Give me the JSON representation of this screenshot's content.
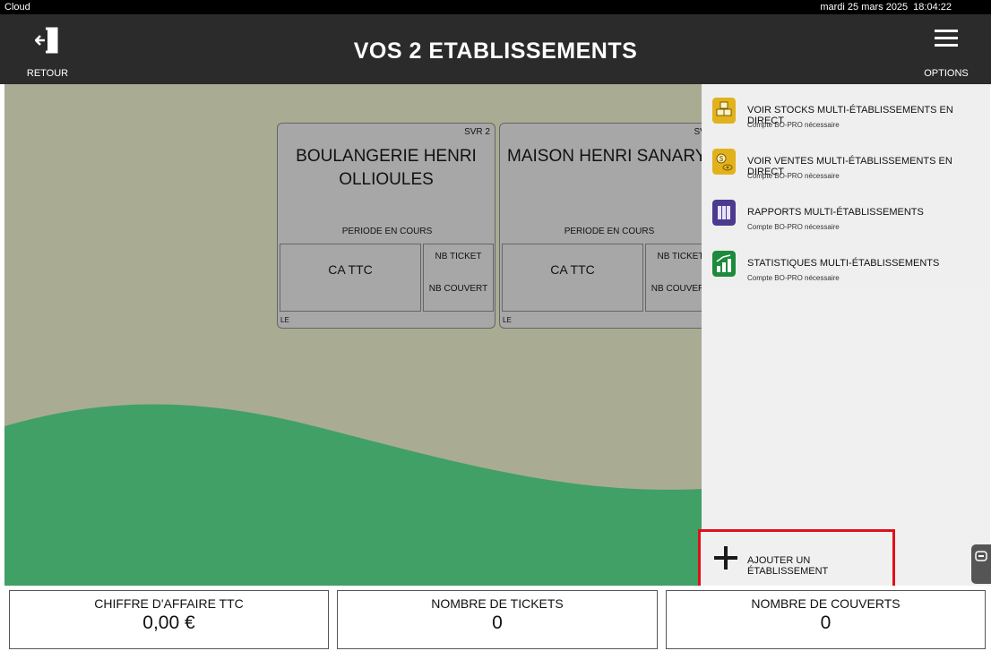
{
  "system": {
    "app_name": "Cloud",
    "date": "mardi 25 mars 2025",
    "time": "18:04:22"
  },
  "header": {
    "title": "VOS 2 ETABLISSEMENTS",
    "back_label": "RETOUR",
    "options_label": "OPTIONS"
  },
  "establishments": [
    {
      "server": "SVR 2",
      "name_line1": "BOULANGERIE HENRI",
      "name_line2": "OLLIOULES",
      "period": "PERIODE EN COURS",
      "ca_label": "CA TTC",
      "nb_ticket_label": "NB TICKET",
      "nb_couvert_label": "NB COUVERT",
      "footer": "LE"
    },
    {
      "server": "SVR",
      "name_line1": "MAISON HENRI SANARY",
      "name_line2": "",
      "period": "PERIODE EN COURS",
      "ca_label": "CA TTC",
      "nb_ticket_label": "NB TICKET",
      "nb_couvert_label": "NB COUVERT",
      "footer": "LE"
    }
  ],
  "panel": {
    "items": [
      {
        "title": "VOIR STOCKS MULTI-ÉTABLISSEMENTS EN DIRECT",
        "subtitle": "Compte BO-PRO nécessaire",
        "icon": "stock-boxes-icon",
        "color": "#e2b21c"
      },
      {
        "title": "VOIR VENTES MULTI-ÉTABLISSEMENTS EN DIRECT",
        "subtitle": "Compte BO-PRO nécessaire",
        "icon": "sales-coin-icon",
        "color": "#e2b21c"
      },
      {
        "title": "RAPPORTS MULTI-ÉTABLISSEMENTS",
        "subtitle": "Compte BO-PRO nécessaire",
        "icon": "binders-icon",
        "color": "#4b3a8f"
      },
      {
        "title": "STATISTIQUES MULTI-ÉTABLISSEMENTS",
        "subtitle": "Compte BO-PRO nécessaire",
        "icon": "bar-chart-icon",
        "color": "#1e8a3c"
      }
    ],
    "add_label": "AJOUTER UN ÉTABLISSEMENT"
  },
  "footer": {
    "ca_label": "CHIFFRE D'AFFAIRE TTC",
    "ca_value": "0,00 €",
    "tickets_label": "NOMBRE DE TICKETS",
    "tickets_value": "0",
    "couverts_label": "NOMBRE DE COUVERTS",
    "couverts_value": "0"
  },
  "colors": {
    "header": "#2b2b2b",
    "stage": "#a9ac93",
    "wave": "#41a066",
    "highlight": "#e0101a"
  }
}
